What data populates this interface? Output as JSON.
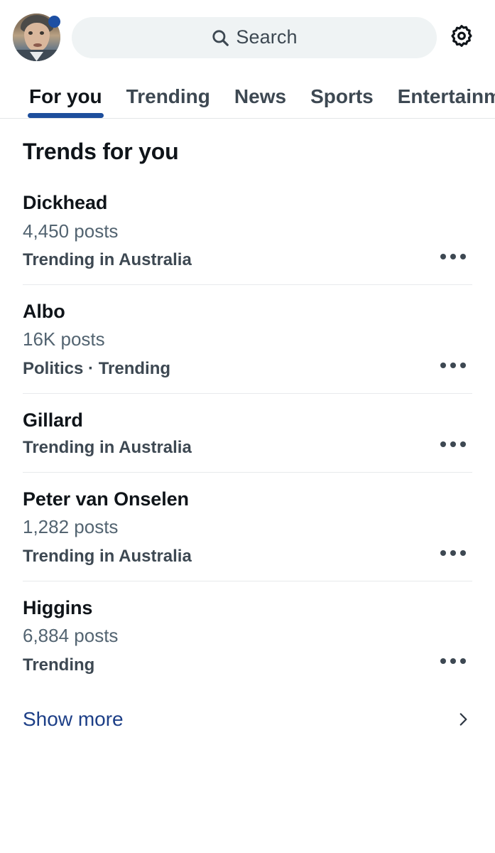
{
  "header": {
    "avatar_name": "profile-avatar",
    "badge_color": "#1d4fa3",
    "search": {
      "placeholder": "Search",
      "value": "",
      "icon": "search-icon"
    },
    "settings_icon": "gear-icon"
  },
  "tabs": [
    {
      "label": "For you",
      "active": true
    },
    {
      "label": "Trending",
      "active": false
    },
    {
      "label": "News",
      "active": false
    },
    {
      "label": "Sports",
      "active": false
    },
    {
      "label": "Entertainm",
      "active": false
    }
  ],
  "section": {
    "title": "Trends for you"
  },
  "trends": [
    {
      "name": "Dickhead",
      "posts": "4,450 posts",
      "meta": "Trending in Australia",
      "more_icon": "more-horizontal-icon"
    },
    {
      "name": "Albo",
      "posts": "16K posts",
      "meta": "Politics · Trending",
      "more_icon": "more-horizontal-icon"
    },
    {
      "name": "Gillard",
      "posts": "",
      "meta": "Trending in Australia",
      "more_icon": "more-horizontal-icon"
    },
    {
      "name": "Peter van Onselen",
      "posts": "1,282 posts",
      "meta": "Trending in Australia",
      "more_icon": "more-horizontal-icon"
    },
    {
      "name": "Higgins",
      "posts": "6,884 posts",
      "meta": "Trending",
      "more_icon": "more-horizontal-icon"
    }
  ],
  "footer": {
    "show_more_label": "Show more",
    "chevron_icon": "chevron-right-icon"
  },
  "colors": {
    "accent_blue": "#1d4e9c",
    "link_blue": "#1d3f87",
    "text_primary": "#0f1419",
    "text_secondary": "#536471",
    "text_meta": "#3d4852",
    "search_bg": "#eff3f4",
    "divider": "#e8eaec"
  }
}
